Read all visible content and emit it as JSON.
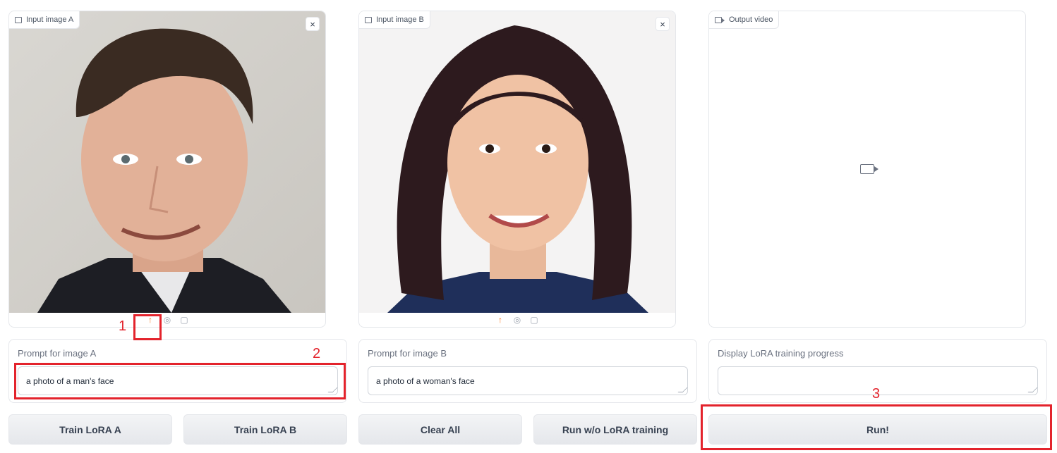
{
  "input_a": {
    "tag_label": "Input image A",
    "close_label": "×"
  },
  "input_b": {
    "tag_label": "Input image B",
    "close_label": "×"
  },
  "output": {
    "tag_label": "Output video"
  },
  "image_tools": {
    "upload": "↑",
    "webcam": "◎",
    "clipboard": "▢"
  },
  "prompt_a": {
    "label": "Prompt for image A",
    "value": "a photo of a man's face"
  },
  "prompt_b": {
    "label": "Prompt for image B",
    "value": "a photo of a woman's face"
  },
  "progress": {
    "label": "Display LoRA training progress",
    "value": ""
  },
  "buttons": {
    "train_a": "Train LoRA A",
    "train_b": "Train LoRA B",
    "clear_all": "Clear All",
    "run_wo_lora": "Run w/o LoRA training",
    "run": "Run!"
  },
  "annotations": {
    "step1": "1",
    "step2": "2",
    "step3": "3"
  },
  "colors": {
    "annotation": "#e3232c",
    "upload_icon": "#f97316",
    "panel_border": "#e5e7eb"
  }
}
